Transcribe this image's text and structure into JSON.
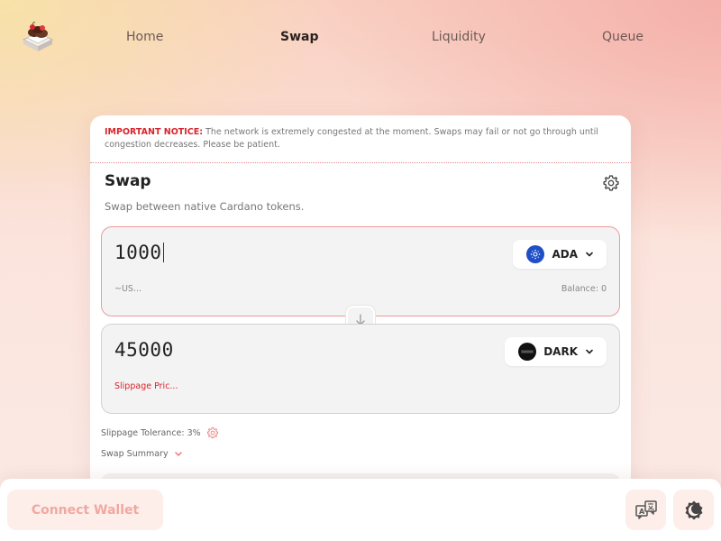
{
  "nav": {
    "items": [
      {
        "label": "Home",
        "active": false
      },
      {
        "label": "Swap",
        "active": true
      },
      {
        "label": "Liquidity",
        "active": false
      },
      {
        "label": "Queue",
        "active": false
      }
    ]
  },
  "notice": {
    "title": "IMPORTANT NOTICE:",
    "text": "The network is extremely congested at the moment. Swaps may fail or not go through until congestion decreases. Please be patient."
  },
  "swap": {
    "title": "Swap",
    "subtitle": "Swap between native Cardano tokens.",
    "from": {
      "amount": "1000",
      "usd": "~US...",
      "balance": "Balance: 0",
      "token": "ADA",
      "token_icon": "cardano-icon"
    },
    "to": {
      "amount": "45000",
      "slippage_price": "Slippage Pric...",
      "token": "DARK",
      "token_icon": "dark-token-icon"
    },
    "slippage_tolerance": "Slippage Tolerance: 3%",
    "summary_label": "Swap Summary"
  },
  "bottom": {
    "connect_label": "Connect Wallet",
    "language_icon": "translate-icon",
    "theme_icon": "moon-icon"
  },
  "colors": {
    "accent_red": "#d8242b",
    "pink_soft": "#fdeeea",
    "connect_text": "#f0a8a0",
    "ada_blue": "#1f4fc6"
  }
}
